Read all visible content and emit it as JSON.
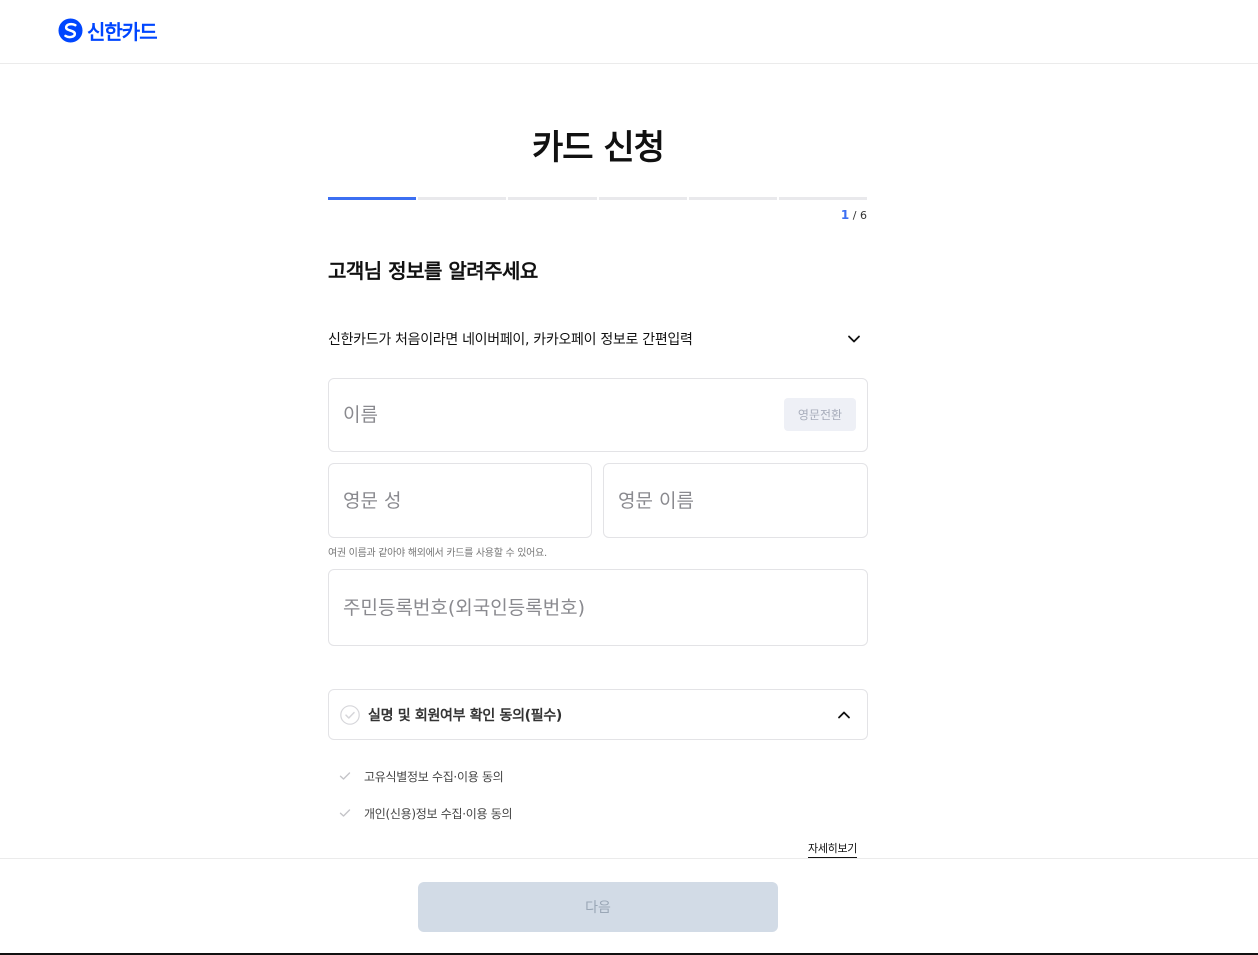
{
  "header": {
    "logo_text": "신한카드",
    "logo_icon": "shinhan-logo-icon"
  },
  "page": {
    "title": "카드 신청"
  },
  "progress": {
    "current": 1,
    "total": 6,
    "separator": "/",
    "total_label": "6",
    "current_label": "1"
  },
  "form": {
    "section_title": "고객님 정보를 알려주세요",
    "easy_input_label": "신한카드가 처음이라면 네이버페이, 카카오페이 정보로 간편입력",
    "name_placeholder": "이름",
    "name_value": "",
    "english_convert_label": "영문전환",
    "english_last_placeholder": "영문 성",
    "english_first_placeholder": "영문 이름",
    "passport_hint": "여권 이름과 같아야 해외에서 카드를 사용할 수 있어요.",
    "rrn_placeholder": "주민등록번호(외국인등록번호)"
  },
  "agreement": {
    "main_label": "실명 및 회원여부 확인 동의(필수)",
    "items": [
      {
        "label": "고유식별정보 수집·이용 동의"
      },
      {
        "label": "개인(신용)정보 수집·이용 동의"
      }
    ],
    "detail_link": "자세히보기"
  },
  "footer": {
    "next_label": "다음"
  },
  "colors": {
    "brand": "#0046ff",
    "accent": "#3c6ff2",
    "disabled_button": "#d2dbe6"
  }
}
